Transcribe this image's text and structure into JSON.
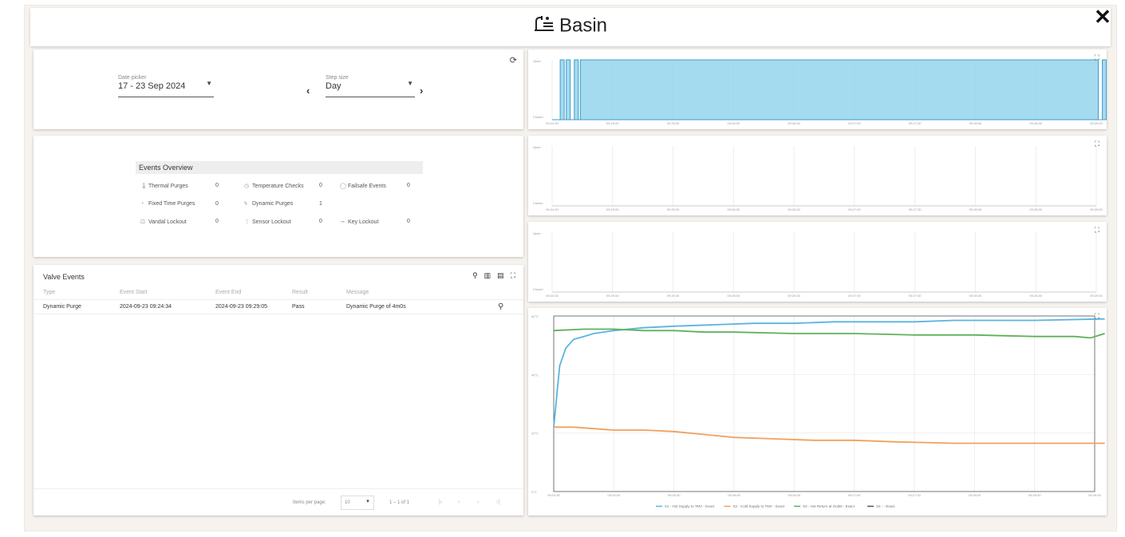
{
  "header": {
    "title": "Basin",
    "close_label": "✕"
  },
  "date_picker": {
    "label": "Date picker",
    "value": "17 - 23 Sep 2024"
  },
  "step": {
    "label": "Step size",
    "value": "Day",
    "prev": "‹",
    "next": "›"
  },
  "refresh_icon": "⟳",
  "events_overview": {
    "title": "Events Overview",
    "items": [
      {
        "label": "Thermal Purges",
        "value": "0",
        "icon": "thermometer-icon"
      },
      {
        "label": "Temperature Checks",
        "value": "0",
        "icon": "clock-icon"
      },
      {
        "label": "Failsafe Events",
        "value": "0",
        "icon": "shield-icon"
      },
      {
        "label": "Fixed Time Purges",
        "value": "0",
        "icon": "timer-icon"
      },
      {
        "label": "Dynamic Purges",
        "value": "1",
        "icon": "bolt-icon"
      },
      {
        "label": "Vandal Lockout",
        "value": "0",
        "icon": "lock-icon"
      },
      {
        "label": "Sensor Lockout",
        "value": "0",
        "icon": "sensor-icon"
      },
      {
        "label": "Key Lockout",
        "value": "0",
        "icon": "key-icon"
      }
    ]
  },
  "valve_events": {
    "title": "Valve Events",
    "columns": [
      "Type",
      "Event Start",
      "Event End",
      "Result",
      "Message"
    ],
    "rows": [
      {
        "type": "Dynamic Purge",
        "start": "2024-09-23 09:24:34",
        "end": "2024-09-23 09:29:05",
        "result": "Pass",
        "message": "Dynamic Purge of 4m0s"
      }
    ],
    "items_per_page_label": "Items per page:",
    "items_per_page": "10",
    "range": "1 – 1 of 1"
  },
  "chart_data": [
    {
      "type": "line",
      "ylabels": [
        "Open",
        "Closed"
      ],
      "x_ticks": [
        "09:24:30",
        "09:25:00",
        "09:25:30",
        "09:26:00",
        "09:26:30",
        "09:27:00",
        "09:27:30",
        "09:28:00",
        "09:28:30",
        "09:29:00"
      ],
      "step_series": [
        {
          "t": "09:24:30",
          "v": 0
        },
        {
          "t": "09:24:34",
          "v": 1
        },
        {
          "t": "09:24:36",
          "v": 0
        },
        {
          "t": "09:24:37",
          "v": 1
        },
        {
          "t": "09:24:39",
          "v": 0
        },
        {
          "t": "09:24:41",
          "v": 1
        },
        {
          "t": "09:24:43",
          "v": 0
        },
        {
          "t": "09:24:44",
          "v": 1
        },
        {
          "t": "09:29:00",
          "v": 1
        },
        {
          "t": "09:29:01",
          "v": 0
        },
        {
          "t": "09:29:03",
          "v": 1
        },
        {
          "t": "09:29:05",
          "v": 0
        },
        {
          "t": "09:29:06",
          "v": 1
        },
        {
          "t": "09:29:08",
          "v": 0
        },
        {
          "t": "09:29:10",
          "v": 1
        },
        {
          "t": "09:29:12",
          "v": 0
        }
      ],
      "color": "#87cfea"
    },
    {
      "type": "line",
      "ylabels": [
        "Open",
        "Closed"
      ],
      "x_ticks": [
        "09:24:30",
        "09:25:00",
        "09:25:30",
        "09:26:00",
        "09:26:30",
        "09:27:00",
        "09:27:30",
        "09:28:00",
        "09:28:30",
        "09:29:00"
      ],
      "series": []
    },
    {
      "type": "line",
      "ylabels": [
        "Open",
        "Closed"
      ],
      "x_ticks": [
        "09:24:30",
        "09:25:00",
        "09:25:30",
        "09:26:00",
        "09:26:30",
        "09:27:00",
        "09:27:30",
        "09:28:00",
        "09:28:30",
        "09:29:00"
      ],
      "series": []
    },
    {
      "type": "line",
      "y_ticks": [
        "0°C",
        "20°C",
        "40°C",
        "60°C"
      ],
      "ylim": [
        0,
        60
      ],
      "x_ticks": [
        "09:24:30",
        "09:25:00",
        "09:25:30",
        "09:26:00",
        "09:26:30",
        "09:27:00",
        "09:27:30",
        "09:28:00",
        "09:28:30",
        "09:29:00"
      ],
      "series": [
        {
          "name": "S1 - Hot Supply to TMV - Exact",
          "color": "#5ab4df",
          "points": [
            [
              0,
              22
            ],
            [
              3,
              43
            ],
            [
              6,
              49
            ],
            [
              10,
              52
            ],
            [
              15,
              53
            ],
            [
              20,
              54
            ],
            [
              30,
              55
            ],
            [
              45,
              56
            ],
            [
              60,
              56.5
            ],
            [
              80,
              57
            ],
            [
              100,
              57.5
            ],
            [
              120,
              57.5
            ],
            [
              140,
              58
            ],
            [
              160,
              58
            ],
            [
              180,
              58
            ],
            [
              200,
              58.5
            ],
            [
              240,
              58.5
            ],
            [
              275,
              59
            ]
          ]
        },
        {
          "name": "S2 - Cold Supply to TMV - Exact",
          "color": "#f0a15e",
          "points": [
            [
              0,
              22
            ],
            [
              10,
              22
            ],
            [
              20,
              21.5
            ],
            [
              30,
              21
            ],
            [
              45,
              21
            ],
            [
              60,
              20.5
            ],
            [
              75,
              19.5
            ],
            [
              90,
              18.5
            ],
            [
              110,
              18
            ],
            [
              130,
              17.5
            ],
            [
              150,
              17.5
            ],
            [
              170,
              17
            ],
            [
              200,
              16.5
            ],
            [
              240,
              16.5
            ],
            [
              275,
              16.5
            ]
          ]
        },
        {
          "name": "S3 - Hot Return at Outlet - Exact",
          "color": "#5eb15a",
          "points": [
            [
              0,
              55
            ],
            [
              15,
              55.5
            ],
            [
              30,
              55.5
            ],
            [
              45,
              55
            ],
            [
              60,
              55
            ],
            [
              75,
              54.5
            ],
            [
              90,
              54.5
            ],
            [
              120,
              54
            ],
            [
              150,
              54
            ],
            [
              180,
              53.5
            ],
            [
              210,
              53.5
            ],
            [
              240,
              53
            ],
            [
              260,
              53
            ],
            [
              268,
              52.5
            ],
            [
              275,
              54
            ]
          ]
        },
        {
          "name": "S4 - - Exact",
          "color": "#555555",
          "points": []
        }
      ]
    }
  ]
}
